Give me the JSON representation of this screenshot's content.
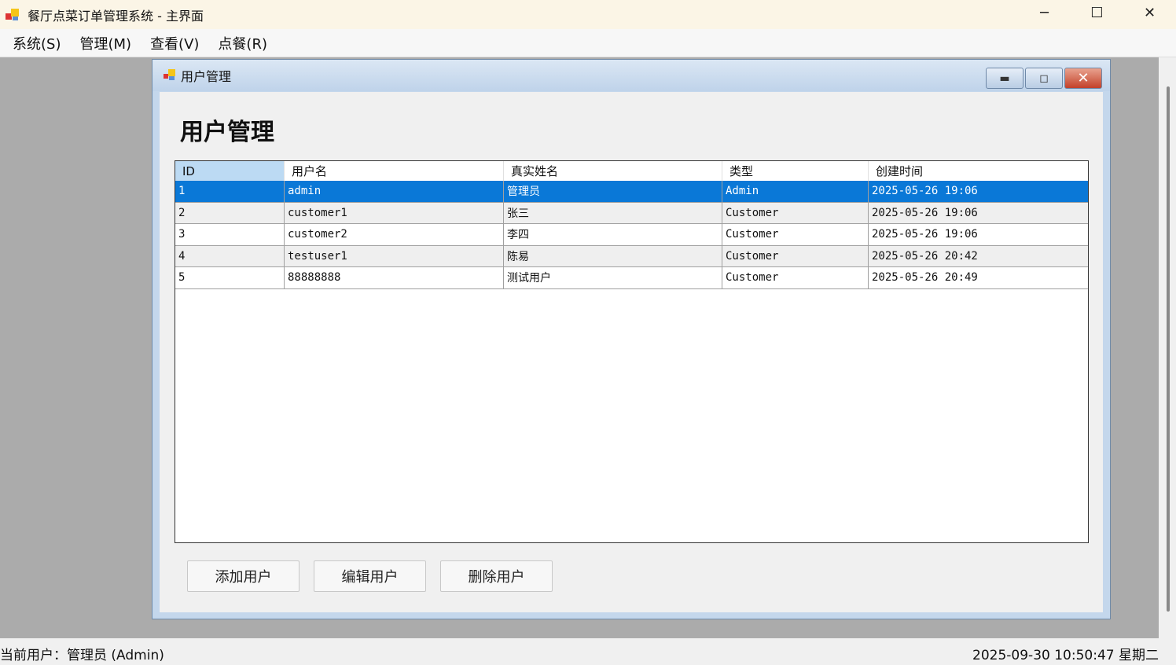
{
  "app": {
    "title": "餐厅点菜订单管理系统 - 主界面",
    "minimize": "─",
    "maximize": "☐",
    "close": "✕"
  },
  "menu": [
    "系统(S)",
    "管理(M)",
    "查看(V)",
    "点餐(R)"
  ],
  "child": {
    "title": "用户管理",
    "heading": "用户管理",
    "minimize": "▬",
    "restore": "◻",
    "close": "✕"
  },
  "table": {
    "columns": [
      "ID",
      "用户名",
      "真实姓名",
      "类型",
      "创建时间"
    ],
    "rows": [
      [
        "1",
        "admin",
        "管理员",
        "Admin",
        "2025-05-26 19:06"
      ],
      [
        "2",
        "customer1",
        "张三",
        "Customer",
        "2025-05-26 19:06"
      ],
      [
        "3",
        "customer2",
        "李四",
        "Customer",
        "2025-05-26 19:06"
      ],
      [
        "4",
        "testuser1",
        "陈易",
        "Customer",
        "2025-05-26 20:42"
      ],
      [
        "5",
        "88888888",
        "测试用户",
        "Customer",
        "2025-05-26 20:49"
      ]
    ],
    "selected_row": 0
  },
  "buttons": {
    "add": "添加用户",
    "edit": "编辑用户",
    "delete": "删除用户"
  },
  "status": {
    "user": "当前用户：管理员 (Admin)",
    "datetime": "2025-09-30 10:50:47 星期二"
  }
}
